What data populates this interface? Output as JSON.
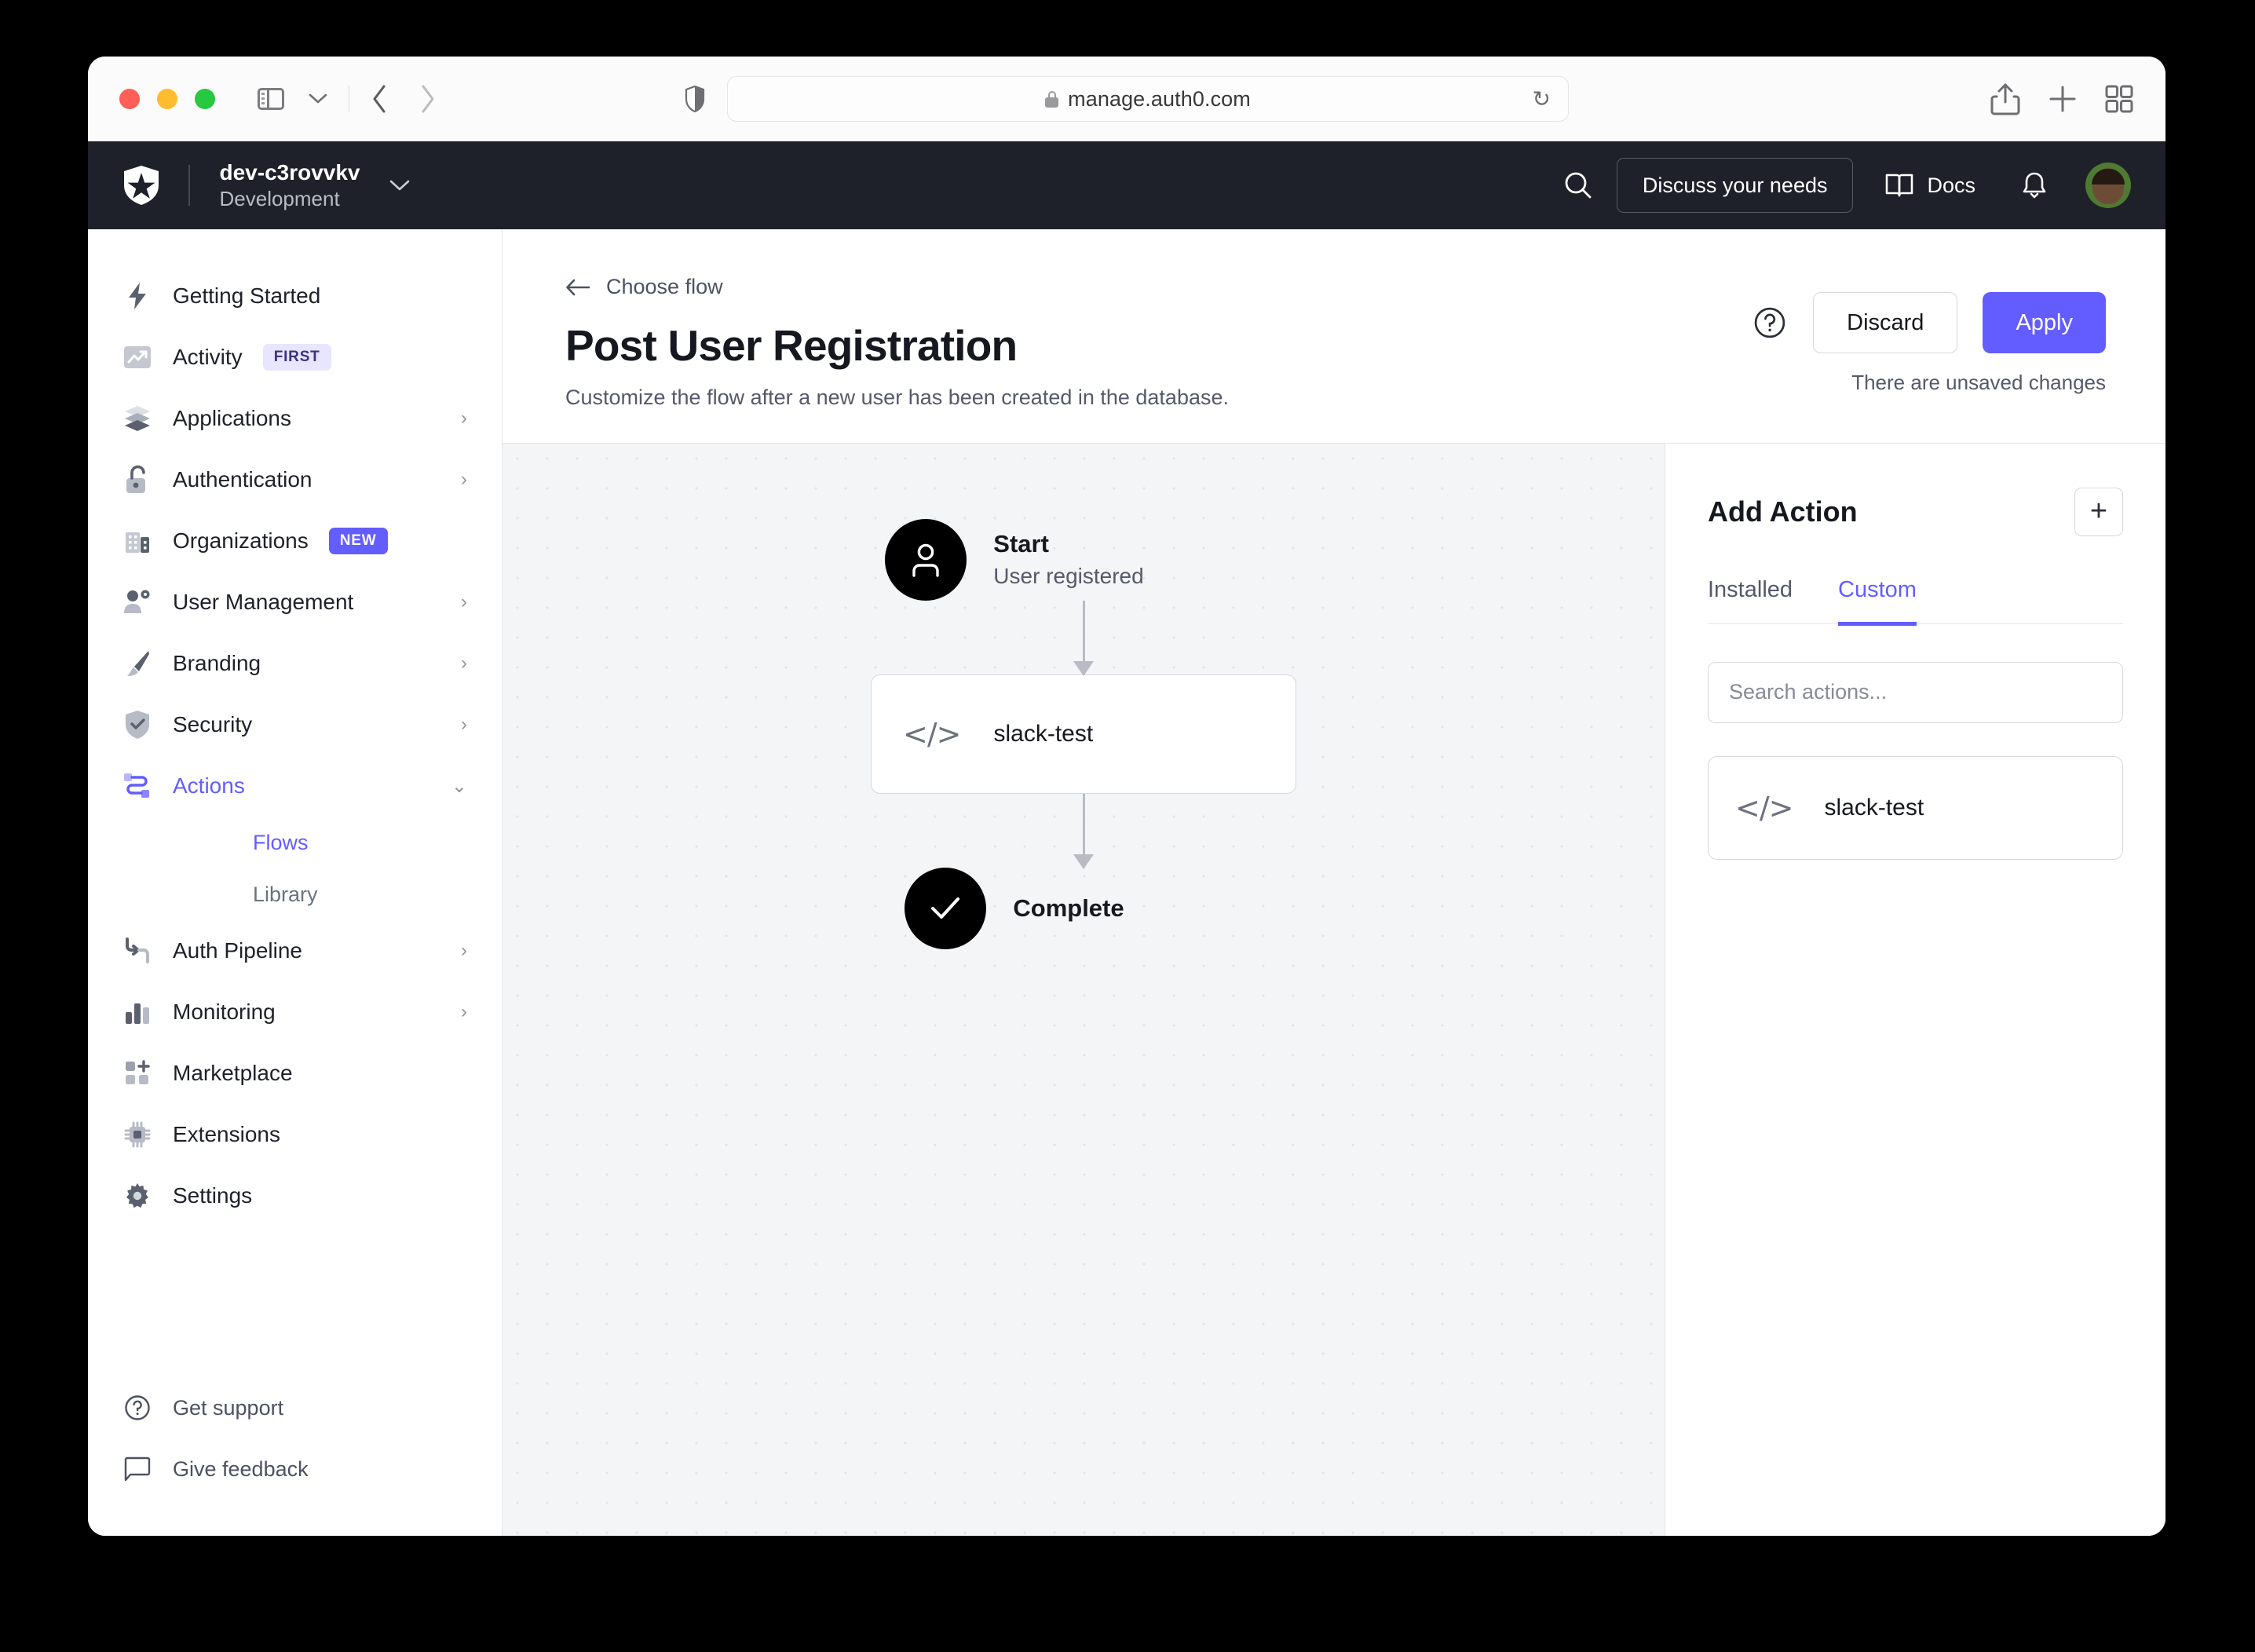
{
  "browser": {
    "url": "manage.auth0.com",
    "lock_icon": "lock-icon",
    "shield_icon": "shield-icon",
    "reload_icon": "reload-icon",
    "sidebar_toggle_icon": "sidebar-toggle-icon",
    "back_icon": "chevron-left-icon",
    "forward_icon": "chevron-right-icon",
    "share_icon": "share-icon",
    "new_tab_icon": "plus-icon",
    "tab_overview_icon": "tab-overview-icon"
  },
  "header": {
    "logo": "auth0-logo",
    "tenant_name": "dev-c3rovvkv",
    "tenant_env": "Development",
    "tenant_chevron": "chevron-down-icon",
    "search_icon": "search-icon",
    "discuss_label": "Discuss your needs",
    "docs_label": "Docs",
    "docs_icon": "book-icon",
    "bell_icon": "bell-icon",
    "avatar": "user-avatar"
  },
  "sidebar": {
    "items": [
      {
        "label": "Getting Started",
        "icon": "lightning-icon",
        "chevron": false
      },
      {
        "label": "Activity",
        "icon": "trending-up-icon",
        "chevron": false,
        "badge": "FIRST",
        "badge_kind": "first"
      },
      {
        "label": "Applications",
        "icon": "layers-icon",
        "chevron": true
      },
      {
        "label": "Authentication",
        "icon": "lock-open-icon",
        "chevron": true
      },
      {
        "label": "Organizations",
        "icon": "building-icon",
        "chevron": false,
        "badge": "NEW",
        "badge_kind": "new"
      },
      {
        "label": "User Management",
        "icon": "user-gear-icon",
        "chevron": true
      },
      {
        "label": "Branding",
        "icon": "paintbrush-icon",
        "chevron": true
      },
      {
        "label": "Security",
        "icon": "shield-check-icon",
        "chevron": true
      },
      {
        "label": "Actions",
        "icon": "actions-icon",
        "chevron": true,
        "expanded": true,
        "active": true
      },
      {
        "label": "Auth Pipeline",
        "icon": "pipeline-icon",
        "chevron": true
      },
      {
        "label": "Monitoring",
        "icon": "bar-chart-icon",
        "chevron": true
      },
      {
        "label": "Marketplace",
        "icon": "marketplace-icon",
        "chevron": false
      },
      {
        "label": "Extensions",
        "icon": "chip-icon",
        "chevron": false
      },
      {
        "label": "Settings",
        "icon": "gear-icon",
        "chevron": false
      }
    ],
    "actions_children": [
      {
        "label": "Flows",
        "active": true
      },
      {
        "label": "Library",
        "active": false
      }
    ],
    "bottom": [
      {
        "label": "Get support",
        "icon": "question-circle-icon"
      },
      {
        "label": "Give feedback",
        "icon": "chat-bubble-icon"
      }
    ]
  },
  "page": {
    "back_label": "Choose flow",
    "back_icon": "arrow-left-icon",
    "title": "Post User Registration",
    "subtitle": "Customize the flow after a new user has been created in the database.",
    "help_icon": "question-circle-icon",
    "discard_label": "Discard",
    "apply_label": "Apply",
    "unsaved_label": "There are unsaved changes"
  },
  "flow": {
    "start": {
      "title": "Start",
      "subtitle": "User registered",
      "icon": "person-icon"
    },
    "nodes": [
      {
        "name": "slack-test",
        "icon": "code-icon"
      }
    ],
    "complete": {
      "title": "Complete",
      "icon": "check-icon"
    }
  },
  "panel": {
    "title": "Add Action",
    "add_icon": "plus-icon",
    "tabs": [
      {
        "label": "Installed",
        "active": false
      },
      {
        "label": "Custom",
        "active": true
      }
    ],
    "search_placeholder": "Search actions...",
    "search_value": "",
    "cards": [
      {
        "name": "slack-test",
        "icon": "code-icon"
      }
    ]
  },
  "colors": {
    "accent": "#635dff",
    "header_bg": "#1e212a",
    "canvas_bg": "#f4f5f7",
    "text_primary": "#16181f",
    "text_secondary": "#55596a"
  }
}
